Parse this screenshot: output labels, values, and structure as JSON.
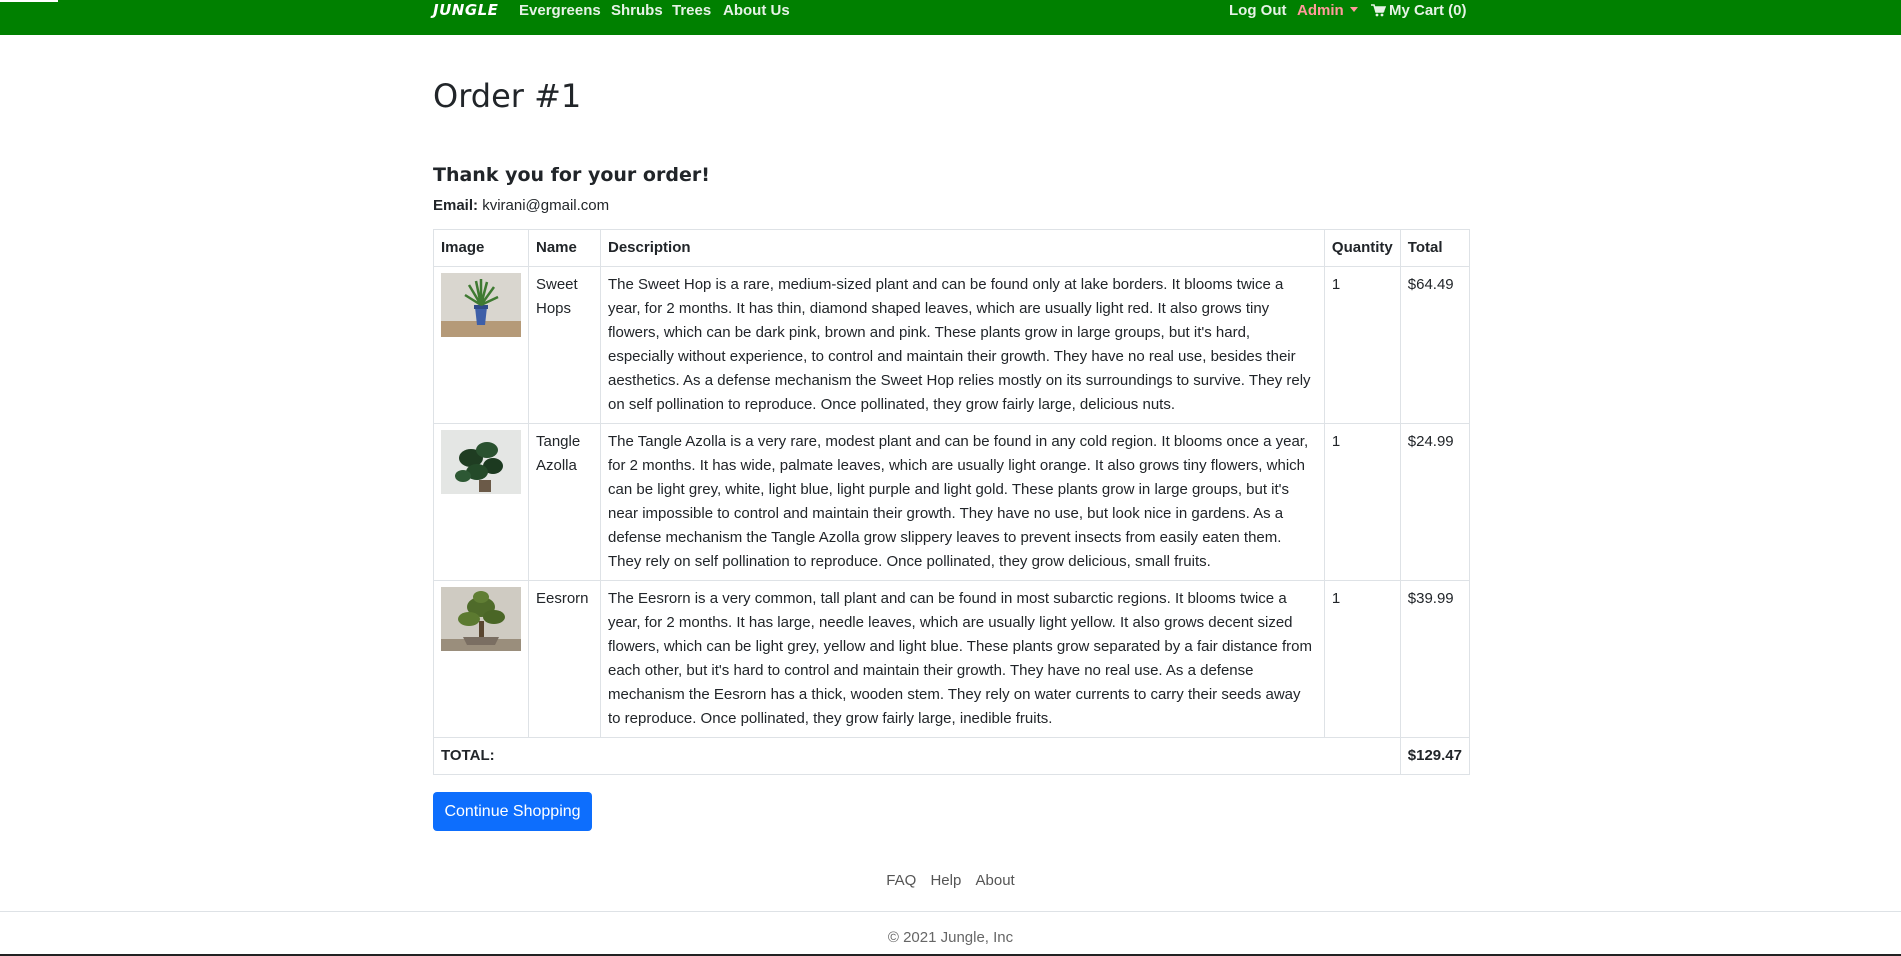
{
  "nav": {
    "brand": "JUNGLE",
    "links": [
      "Evergreens",
      "Shrubs",
      "Trees",
      "About Us"
    ],
    "logout": "Log Out",
    "admin": "Admin",
    "cart": "My Cart (0)"
  },
  "order": {
    "title": "Order #1",
    "thanks": "Thank you for your order!",
    "email_label": "Email:",
    "email": "kvirani@gmail.com"
  },
  "table": {
    "headers": [
      "Image",
      "Name",
      "Description",
      "Quantity",
      "Total"
    ],
    "rows": [
      {
        "name": "Sweet Hops",
        "description": "The Sweet Hop is a rare, medium-sized plant and can be found only at lake borders. It blooms twice a year, for 2 months. It has thin, diamond shaped leaves, which are usually light red. It also grows tiny flowers, which can be dark pink, brown and pink. These plants grow in large groups, but it's hard, especially without experience, to control and maintain their growth. They have no real use, besides their aesthetics. As a defense mechanism the Sweet Hop relies mostly on its surroundings to survive. They rely on self pollination to reproduce. Once pollinated, they grow fairly large, delicious nuts.",
        "quantity": "1",
        "total": "$64.49",
        "image_icon": "potted-plant-photo"
      },
      {
        "name": "Tangle Azolla",
        "description": "The Tangle Azolla is a very rare, modest plant and can be found in any cold region. It blooms once a year, for 2 months. It has wide, palmate leaves, which are usually light orange. It also grows tiny flowers, which can be light grey, white, light blue, light purple and light gold. These plants grow in large groups, but it's near impossible to control and maintain their growth. They have no use, but look nice in gardens. As a defense mechanism the Tangle Azolla grow slippery leaves to prevent insects from easily eaten them. They rely on self pollination to reproduce. Once pollinated, they grow delicious, small fruits.",
        "quantity": "1",
        "total": "$24.99",
        "image_icon": "leafy-plant-photo"
      },
      {
        "name": "Eesrorn",
        "description": "The Eesrorn is a very common, tall plant and can be found in most subarctic regions. It blooms twice a year, for 2 months. It has large, needle leaves, which are usually light yellow. It also grows decent sized flowers, which can be light grey, yellow and light blue. These plants grow separated by a fair distance from each other, but it's hard to control and maintain their growth. They have no real use. As a defense mechanism the Eesrorn has a thick, wooden stem. They rely on water currents to carry their seeds away to reproduce. Once pollinated, they grow fairly large, inedible fruits.",
        "quantity": "1",
        "total": "$39.99",
        "image_icon": "bonsai-tree-photo"
      }
    ],
    "total_label": "TOTAL:",
    "grand_total": "$129.47"
  },
  "actions": {
    "continue": "Continue Shopping"
  },
  "footer": {
    "links": [
      "FAQ",
      "Help",
      "About"
    ],
    "copyright": "© 2021 Jungle, Inc"
  },
  "colors": {
    "navbar": "#008000",
    "admin": "#ff9a9a",
    "button": "#0d6efd"
  }
}
